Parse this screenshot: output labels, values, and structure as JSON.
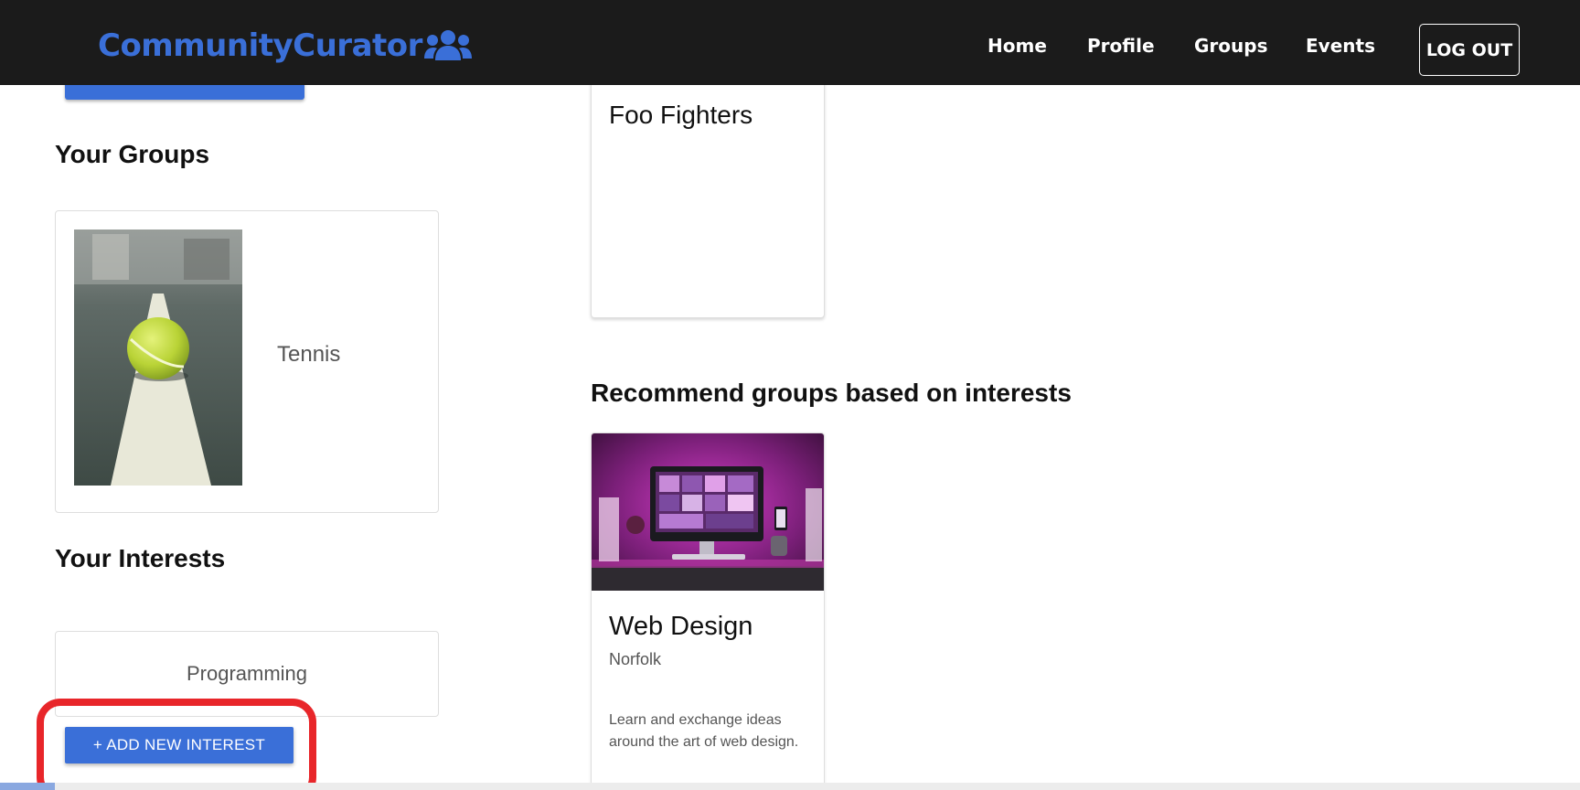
{
  "navbar": {
    "brand": "CommunityCurator",
    "brand_icon": "users-icon",
    "links": [
      "Home",
      "Profile",
      "Groups",
      "Events"
    ],
    "logout_label": "LOG OUT"
  },
  "left": {
    "your_groups_title": "Your Groups",
    "groups": [
      {
        "name": "Tennis",
        "image": "tennis-ball-image"
      }
    ],
    "your_interests_title": "Your Interests",
    "interests": [
      "Programming"
    ],
    "add_interest_label": "+ ADD NEW INTEREST"
  },
  "right": {
    "top_card_title": "Foo Fighters",
    "recommend_title": "Recommend groups based on interests",
    "recommended": [
      {
        "title": "Web Design",
        "location": "Norfolk",
        "description": "Learn and exchange ideas around the art of web design.",
        "image": "computer-desk-image"
      }
    ]
  },
  "colors": {
    "navbar_bg": "#1b1b1b",
    "brand": "#3a6fd8",
    "button": "#3a6fd8",
    "highlight": "#e8262a"
  }
}
